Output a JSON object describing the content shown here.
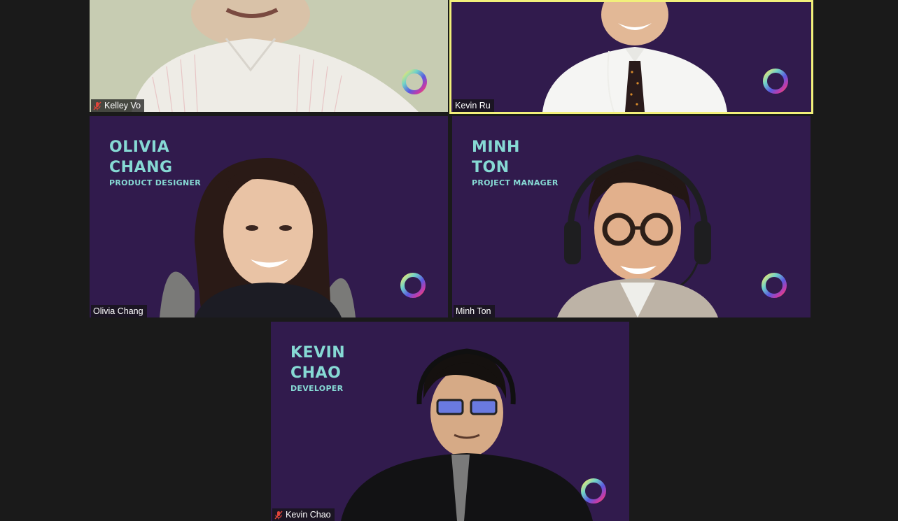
{
  "participants": [
    {
      "id": "kelley",
      "display_name": "Kelley Vo",
      "muted": true,
      "active_speaker": false,
      "background": "light"
    },
    {
      "id": "kevinru",
      "display_name": "Kevin Ru",
      "muted": false,
      "active_speaker": true,
      "background": "purple"
    },
    {
      "id": "olivia",
      "display_name": "Olivia Chang",
      "muted": false,
      "active_speaker": false,
      "background": "purple",
      "card": {
        "name_line1": "OLIVIA",
        "name_line2": "CHANG",
        "role": "PRODUCT DESIGNER"
      }
    },
    {
      "id": "minh",
      "display_name": "Minh Ton",
      "muted": false,
      "active_speaker": false,
      "background": "purple",
      "card": {
        "name_line1": "MINH",
        "name_line2": "TON",
        "role": "PROJECT MANAGER"
      }
    },
    {
      "id": "kevinchao",
      "display_name": "Kevin Chao",
      "muted": true,
      "active_speaker": false,
      "background": "purple",
      "card": {
        "name_line1": "KEVIN",
        "name_line2": "CHAO",
        "role": "DEVELOPER"
      }
    }
  ],
  "colors": {
    "app_background": "#1a1a1a",
    "tile_purple": "#311b4d",
    "card_text": "#86d9d4",
    "active_speaker_border": "#f2f07a",
    "mute_icon": "#e0453a"
  },
  "icons": {
    "mute": "microphone-muted-icon",
    "logo": "brand-ring-logo"
  }
}
